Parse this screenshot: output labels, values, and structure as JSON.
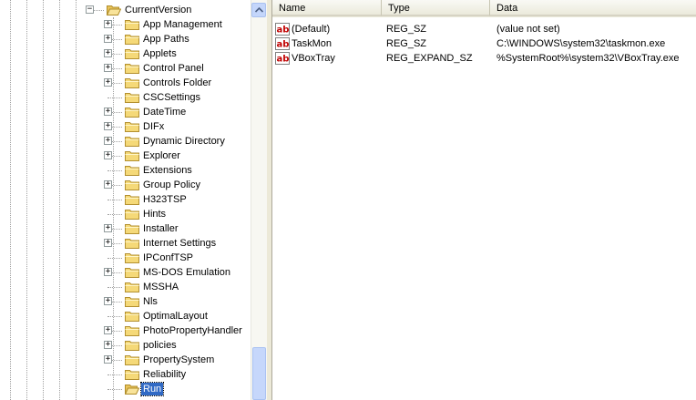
{
  "tree": {
    "parent": {
      "label": "CurrentVersion",
      "expander": "−"
    },
    "items": [
      {
        "label": "App Management",
        "expandable": true
      },
      {
        "label": "App Paths",
        "expandable": true
      },
      {
        "label": "Applets",
        "expandable": true
      },
      {
        "label": "Control Panel",
        "expandable": true
      },
      {
        "label": "Controls Folder",
        "expandable": true
      },
      {
        "label": "CSCSettings",
        "expandable": false
      },
      {
        "label": "DateTime",
        "expandable": true
      },
      {
        "label": "DIFx",
        "expandable": true
      },
      {
        "label": "Dynamic Directory",
        "expandable": true
      },
      {
        "label": "Explorer",
        "expandable": true
      },
      {
        "label": "Extensions",
        "expandable": false
      },
      {
        "label": "Group Policy",
        "expandable": true
      },
      {
        "label": "H323TSP",
        "expandable": false
      },
      {
        "label": "Hints",
        "expandable": false
      },
      {
        "label": "Installer",
        "expandable": true
      },
      {
        "label": "Internet Settings",
        "expandable": true
      },
      {
        "label": "IPConfTSP",
        "expandable": false
      },
      {
        "label": "MS-DOS Emulation",
        "expandable": true
      },
      {
        "label": "MSSHA",
        "expandable": false
      },
      {
        "label": "Nls",
        "expandable": true
      },
      {
        "label": "OptimalLayout",
        "expandable": false
      },
      {
        "label": "PhotoPropertyHandler",
        "expandable": true
      },
      {
        "label": "policies",
        "expandable": true
      },
      {
        "label": "PropertySystem",
        "expandable": true
      },
      {
        "label": "Reliability",
        "expandable": false
      },
      {
        "label": "Run",
        "expandable": false,
        "selected": true
      }
    ],
    "expander_plus": "+"
  },
  "list": {
    "columns": {
      "name": "Name",
      "type": "Type",
      "data": "Data"
    },
    "rows": [
      {
        "name": "(Default)",
        "type": "REG_SZ",
        "data": "(value not set)"
      },
      {
        "name": "TaskMon",
        "type": "REG_SZ",
        "data": "C:\\WINDOWS\\system32\\taskmon.exe"
      },
      {
        "name": "VBoxTray",
        "type": "REG_EXPAND_SZ",
        "data": "%SystemRoot%\\system32\\VBoxTray.exe"
      }
    ]
  },
  "icons": {
    "folder": "folder-icon",
    "folder_open": "open-folder-icon",
    "string_value": "string-value-icon"
  },
  "colors": {
    "selection": "#316ac5",
    "folder": "#f5d978",
    "header": "#ebeadb"
  }
}
